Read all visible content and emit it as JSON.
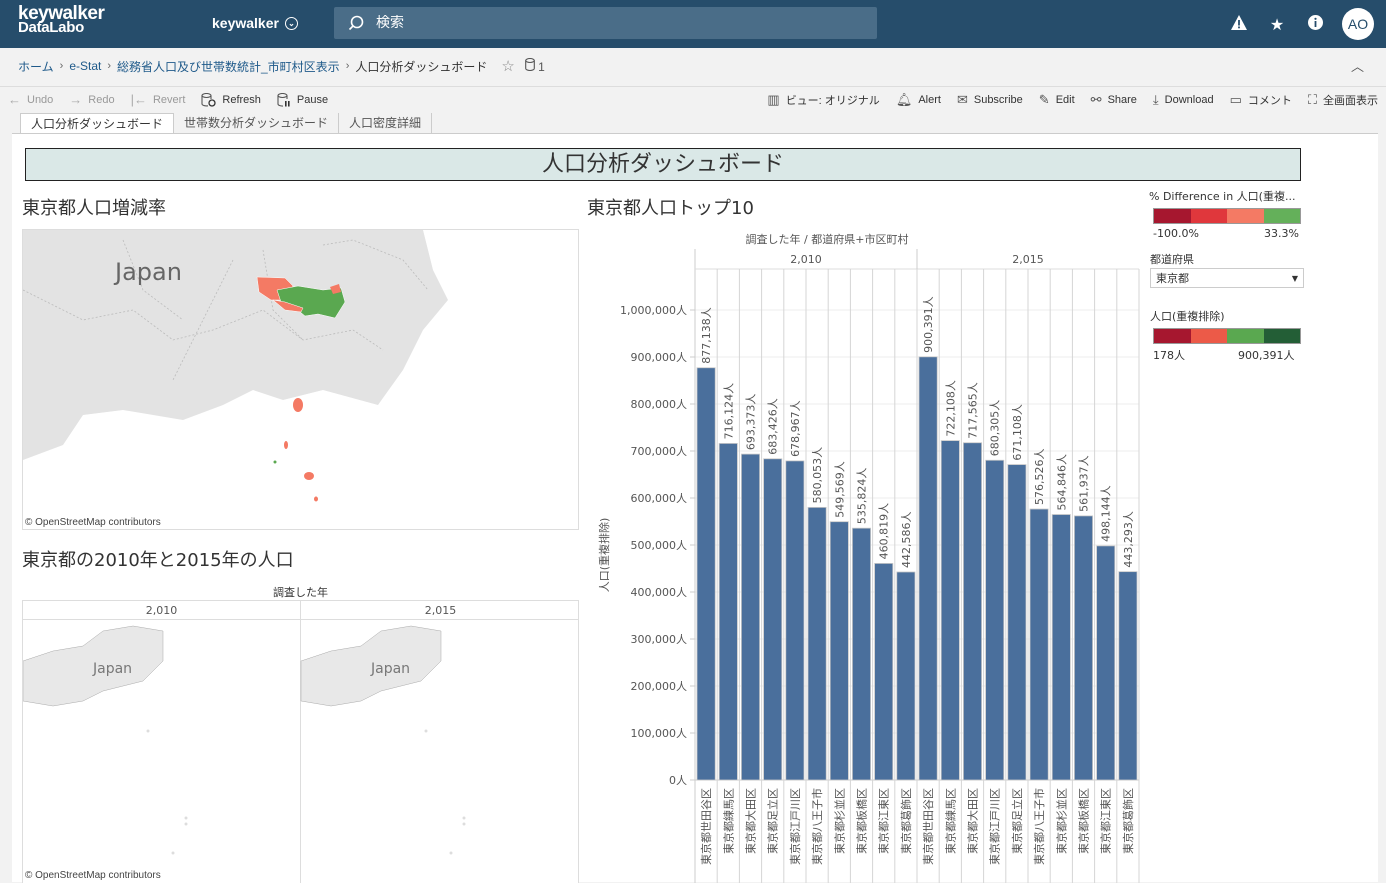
{
  "topbar": {
    "logo_line1": "keywalker",
    "logo_line2": "DataLabo",
    "site_name": "keywalker",
    "search_placeholder": "検索",
    "icons": [
      "alert-triangle-icon",
      "star-icon",
      "info-icon"
    ],
    "avatar": "AO"
  },
  "breadcrumb": {
    "items": [
      "ホーム",
      "e-Stat",
      "総務省人口及び世帯数統計_市町村区表示"
    ],
    "current": "人口分析ダッシュボード",
    "datasource_count": "1"
  },
  "toolbar": {
    "undo": "Undo",
    "redo": "Redo",
    "revert": "Revert",
    "refresh": "Refresh",
    "pause": "Pause",
    "view": "ビュー: オリジナル",
    "alert": "Alert",
    "subscribe": "Subscribe",
    "edit": "Edit",
    "share": "Share",
    "download": "Download",
    "comment": "コメント",
    "fullscreen": "全画面表示"
  },
  "tabs": [
    {
      "label": "人口分析ダッシュボード",
      "active": true
    },
    {
      "label": "世帯数分析ダッシュボード",
      "active": false
    },
    {
      "label": "人口密度詳細",
      "active": false
    }
  ],
  "dashboard": {
    "title": "人口分析ダッシュボード",
    "map1": {
      "title": "東京都人口増減率",
      "country_label": "Japan",
      "attribution": "© OpenStreetMap contributors"
    },
    "map2": {
      "title": "東京都の2010年と2015年の人口",
      "header": "調査した年",
      "panels": [
        "2,010",
        "2,015"
      ],
      "country_label": "Japan",
      "attribution": "© OpenStreetMap contributors"
    },
    "chart_title": "東京都人口トップ10"
  },
  "legends": {
    "diff": {
      "title": "% Difference in 人口(重複...",
      "min": "-100.0%",
      "max": "33.3%",
      "colors": [
        "#a6172f",
        "#e0373c",
        "#f47a64",
        "#64b05a"
      ]
    },
    "filter": {
      "title": "都道府県",
      "value": "東京都"
    },
    "pop": {
      "title": "人口(重複排除)",
      "min": "178人",
      "max": "900,391人",
      "colors": [
        "#a6172f",
        "#ec5a48",
        "#5aa850",
        "#235e36"
      ]
    }
  },
  "chart_data": {
    "type": "bar",
    "title": "東京都人口トップ10",
    "header": "調査した年 / 都道府県+市区町村",
    "ylabel": "人口(重複排除)",
    "ylim": [
      0,
      1000000
    ],
    "yticks": [
      0,
      100000,
      200000,
      300000,
      400000,
      500000,
      600000,
      700000,
      800000,
      900000,
      1000000
    ],
    "ytick_labels": [
      "0人",
      "100,000人",
      "200,000人",
      "300,000人",
      "400,000人",
      "500,000人",
      "600,000人",
      "700,000人",
      "800,000人",
      "900,000人",
      "1,000,000人"
    ],
    "bar_color": "#4a6f9c",
    "groups": [
      {
        "year": "2,010",
        "categories": [
          "東京都世田谷区",
          "東京都練馬区",
          "東京都大田区",
          "東京都足立区",
          "東京都江戸川区",
          "東京都八王子市",
          "東京都杉並区",
          "東京都板橋区",
          "東京都江東区",
          "東京都葛飾区"
        ],
        "values": [
          877138,
          716124,
          693373,
          683426,
          678967,
          580053,
          549569,
          535824,
          460819,
          442586
        ],
        "labels": [
          "877,138人",
          "716,124人",
          "693,373人",
          "683,426人",
          "678,967人",
          "580,053人",
          "549,569人",
          "535,824人",
          "460,819人",
          "442,586人"
        ]
      },
      {
        "year": "2,015",
        "categories": [
          "東京都世田谷区",
          "東京都練馬区",
          "東京都大田区",
          "東京都江戸川区",
          "東京都足立区",
          "東京都八王子市",
          "東京都杉並区",
          "東京都板橋区",
          "東京都江東区",
          "東京都葛飾区"
        ],
        "values": [
          900391,
          722108,
          717565,
          680305,
          671108,
          576526,
          564846,
          561937,
          498144,
          443293
        ],
        "labels": [
          "900,391人",
          "722,108人",
          "717,565人",
          "680,305人",
          "671,108人",
          "576,526人",
          "564,846人",
          "561,937人",
          "498,144人",
          "443,293人"
        ]
      }
    ]
  }
}
